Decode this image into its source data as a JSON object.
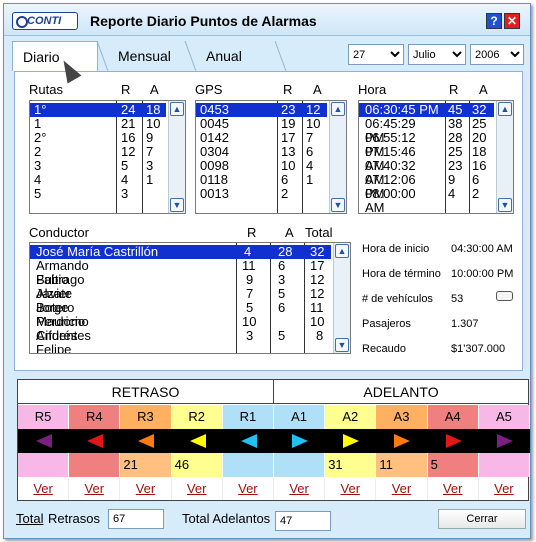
{
  "window": {
    "title": "Reporte Diario Puntos de Alarmas",
    "logo": "CONTI",
    "help": "?",
    "close": "✕"
  },
  "tabs": [
    {
      "label": "Diario"
    },
    {
      "label": "Mensual"
    },
    {
      "label": "Anual"
    }
  ],
  "date": {
    "day": "27",
    "month": "Julio",
    "year": "2006"
  },
  "rutas": {
    "headers": [
      "Rutas",
      "R",
      "A"
    ],
    "rows": [
      [
        "1°",
        "24",
        "18"
      ],
      [
        "1",
        "21",
        "10"
      ],
      [
        "2°",
        "16",
        "9"
      ],
      [
        "2",
        "12",
        "7"
      ],
      [
        "3",
        "5",
        "3"
      ],
      [
        "4",
        "4",
        "1"
      ],
      [
        "5",
        "3",
        ""
      ]
    ]
  },
  "gps": {
    "headers": [
      "GPS",
      "R",
      "A"
    ],
    "rows": [
      [
        "0453",
        "23",
        "12"
      ],
      [
        "0045",
        "19",
        "10"
      ],
      [
        "0142",
        "17",
        "7"
      ],
      [
        "0304",
        "13",
        "6"
      ],
      [
        "0098",
        "10",
        "4"
      ],
      [
        "0118",
        "6",
        "1"
      ],
      [
        "0013",
        "2",
        ""
      ]
    ]
  },
  "hora": {
    "headers": [
      "Hora",
      "R",
      "A"
    ],
    "rows": [
      [
        "06:30:45 PM",
        "45",
        "32"
      ],
      [
        "06:45:29 PM",
        "38",
        "25"
      ],
      [
        "06:55:12 PM",
        "28",
        "20"
      ],
      [
        "07:15:46 AM",
        "25",
        "18"
      ],
      [
        "07:40:32 AM",
        "23",
        "16"
      ],
      [
        "07:12:06 PM",
        "9",
        "6"
      ],
      [
        "08:00:00 AM",
        "4",
        "2"
      ]
    ]
  },
  "conductor": {
    "headers": [
      "Conductor",
      "R",
      "A",
      "Total"
    ],
    "rows": [
      [
        "José María Castrillón",
        "4",
        "28",
        "32"
      ],
      [
        "Armando Buitrago",
        "11",
        "6",
        "17"
      ],
      [
        "Fabio Alzate",
        "9",
        "3",
        "12"
      ],
      [
        "Javier Botero",
        "7",
        "5",
        "12"
      ],
      [
        "Jorge Perdomo",
        "5",
        "6",
        "11"
      ],
      [
        "Mauricio Cifuentes",
        "10",
        "",
        "10"
      ],
      [
        "Andrés Felipe Cadavid",
        "3",
        "5",
        "8"
      ]
    ]
  },
  "info": {
    "inicio_label": "Hora de inicio",
    "inicio": "04:30:00 AM",
    "termino_label": "Hora de término",
    "termino": "10:00:00 PM",
    "vehiculos_label": "# de vehículos",
    "vehiculos": "53",
    "pasajeros_label": "Pasajeros",
    "pasajeros": "1.307",
    "recaudo_label": "Recaudo",
    "recaudo": "$1'307.000"
  },
  "grid": {
    "retraso": "RETRASO",
    "adelanto": "ADELANTO",
    "link": "Ver",
    "cols": [
      {
        "label": "R5",
        "value": "",
        "color": "#f7b8e8",
        "arrow": "#7a2080",
        "dir": "left",
        "cell": "#f7b8e8"
      },
      {
        "label": "R4",
        "value": "",
        "color": "#f08080",
        "arrow": "#e01818",
        "dir": "left",
        "cell": "#f08080"
      },
      {
        "label": "R3",
        "value": "21",
        "color": "#ffb060",
        "arrow": "#ff7a10",
        "dir": "left",
        "cell": "#ffc080"
      },
      {
        "label": "R2",
        "value": "46",
        "color": "#ffff90",
        "arrow": "#ffff00",
        "dir": "left",
        "cell": "#ffff90"
      },
      {
        "label": "R1",
        "value": "",
        "color": "#b0e0f8",
        "arrow": "#20c0f0",
        "dir": "left",
        "cell": "#b0e0f8"
      },
      {
        "label": "A1",
        "value": "",
        "color": "#b0e0f8",
        "arrow": "#20c0f0",
        "dir": "right",
        "cell": "#b0e0f8"
      },
      {
        "label": "A2",
        "value": "31",
        "color": "#ffff90",
        "arrow": "#ffff00",
        "dir": "right",
        "cell": "#ffff90"
      },
      {
        "label": "A3",
        "value": "11",
        "color": "#ffb060",
        "arrow": "#ff7a10",
        "dir": "right",
        "cell": "#ffc080"
      },
      {
        "label": "A4",
        "value": "5",
        "color": "#f08080",
        "arrow": "#e01818",
        "dir": "right",
        "cell": "#f08080"
      },
      {
        "label": "A5",
        "value": "",
        "color": "#f7b8e8",
        "arrow": "#7a2080",
        "dir": "right",
        "cell": "#f7b8e8"
      }
    ]
  },
  "bottom": {
    "total_label": "Total",
    "retrasos_label": "Retrasos",
    "total_retrasos": "67",
    "adelantos_label": "Total Adelantos",
    "total_adelantos": "47",
    "cerrar": "Cerrar"
  }
}
